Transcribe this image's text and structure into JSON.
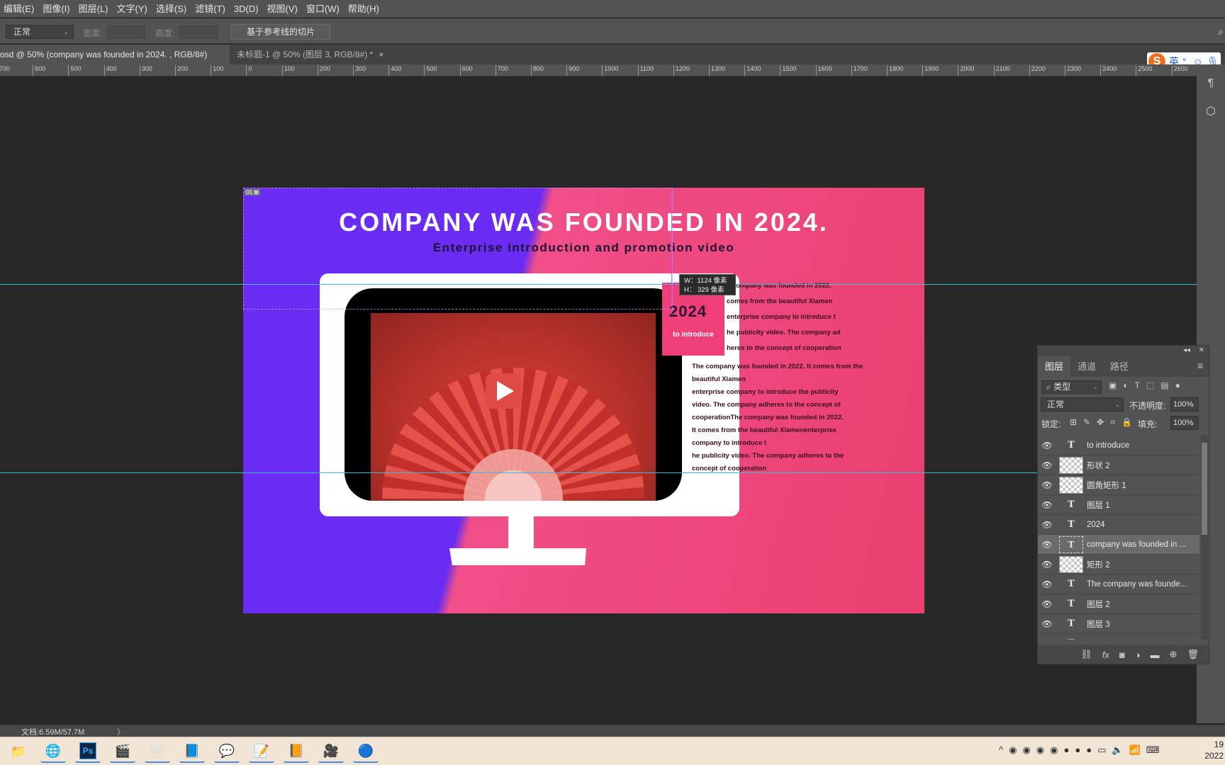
{
  "menu": [
    "编辑(E)",
    "图像(I)",
    "图层(L)",
    "文字(Y)",
    "选择(S)",
    "滤镜(T)",
    "3D(D)",
    "视图(V)",
    "窗口(W)",
    "帮助(H)"
  ],
  "options": {
    "style_value": "正常",
    "width_label": "宽度:",
    "height_label": "高度:",
    "slice_button": "基于参考线的切片"
  },
  "tabs": {
    "active_title": "osd @ 50% (company was founded in 2024. , RGB/8#) *",
    "inactive_title": "未标题-1 @ 50% (图层 3, RGB/8#) *",
    "close": "×"
  },
  "ime": {
    "lang": "英",
    "punct": "°,"
  },
  "ruler": [
    "700",
    "600",
    "500",
    "400",
    "300",
    "200",
    "100",
    "0",
    "100",
    "200",
    "300",
    "400",
    "500",
    "600",
    "700",
    "800",
    "900",
    "1000",
    "1100",
    "1200",
    "1300",
    "1400",
    "1500",
    "1600",
    "1700",
    "1800",
    "1900",
    "2000",
    "2100",
    "2200",
    "2300",
    "2400",
    "2500",
    "2600"
  ],
  "artboard": {
    "badge": "01 ⊠",
    "title": "COMPANY WAS FOUNDED IN 2024.",
    "subtitle": "Enterprise introduction and promotion video",
    "box_year": "2024",
    "box_sub": "to introduce",
    "small_lines": [
      "e company was founded in 2022.",
      "comes from the beautiful Xiamen",
      "enterprise company to introduce t",
      "he publicity video. The company ad",
      "heres to the concept of cooperation"
    ],
    "main_lines": [
      "The company was founded in 2022. It comes from the",
      "beautiful Xiamen",
      "enterprise company to introduce the publicity",
      "video. The company adheres to the concept of",
      "cooperationThe company was founded in 2022.",
      "It comes from the beautiful Xiamenenterprise",
      "company to introduce t",
      "he publicity video. The company adheres to the",
      "concept of cooperation"
    ]
  },
  "tooltip": {
    "w": "W：1124 像素",
    "h": "H：  329 像素"
  },
  "layers_panel": {
    "collapse": "◂◂",
    "close": "✕",
    "tabs": [
      "图层",
      "通道",
      "路径"
    ],
    "filter_kind": "类型",
    "blend_mode": "正常",
    "opacity_label": "不透明度:",
    "opacity_value": "100%",
    "lock_label": "锁定:",
    "fill_label": "填充:",
    "fill_value": "100%",
    "layers": [
      {
        "name": "to introduce",
        "kind": "type"
      },
      {
        "name": "形状 2",
        "kind": "raster"
      },
      {
        "name": "圆角矩形 1",
        "kind": "raster"
      },
      {
        "name": "图层 1",
        "kind": "type"
      },
      {
        "name": "2024",
        "kind": "type"
      },
      {
        "name": "company was founded in ...",
        "kind": "selected"
      },
      {
        "name": "矩形 2",
        "kind": "raster"
      },
      {
        "name": "The company was founde...",
        "kind": "type"
      },
      {
        "name": "图层 2",
        "kind": "type"
      },
      {
        "name": "图层 3",
        "kind": "type"
      },
      {
        "name": "图层",
        "kind": "type"
      }
    ]
  },
  "status": {
    "doc_info": "文档:6.59M/57.7M",
    "arrow": "〉"
  },
  "clock": {
    "time": "19",
    "date": "2022"
  }
}
